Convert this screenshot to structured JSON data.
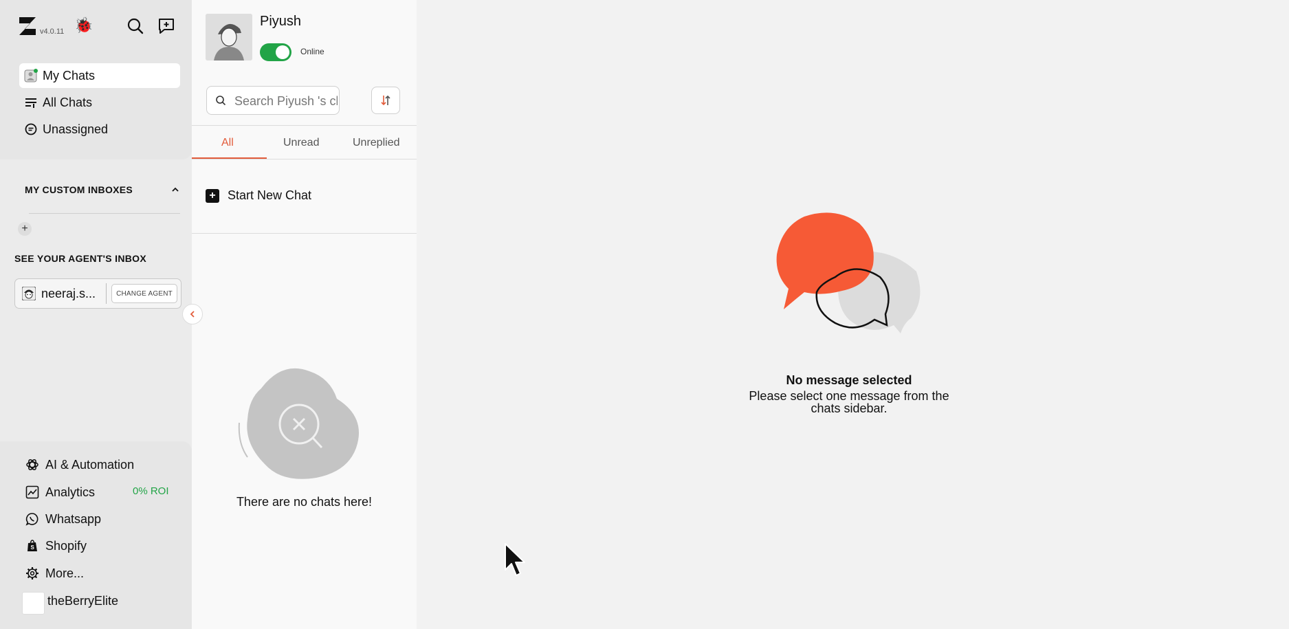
{
  "app": {
    "version": "v4.0.11"
  },
  "sidebar": {
    "nav": [
      {
        "label": "My Chats",
        "active": true
      },
      {
        "label": "All Chats",
        "active": false
      },
      {
        "label": "Unassigned",
        "active": false
      }
    ],
    "custom_inboxes_title": "MY CUSTOM INBOXES",
    "agent_inbox_title": "SEE YOUR AGENT'S INBOX",
    "agent": {
      "name": "neeraj.s...",
      "change_label": "CHANGE AGENT"
    },
    "bottom_nav": [
      {
        "label": "AI & Automation",
        "icon": "openai-icon"
      },
      {
        "label": "Analytics",
        "icon": "chart-icon"
      },
      {
        "label": "Whatsapp",
        "icon": "whatsapp-icon"
      },
      {
        "label": "Shopify",
        "icon": "shopify-icon"
      },
      {
        "label": "More...",
        "icon": "gear-icon"
      }
    ],
    "roi_text": "0% ROI",
    "store_name": "theBerryElite"
  },
  "chatlist": {
    "user_name": "Piyush",
    "status": "Online",
    "search_placeholder": "Search Piyush 's cl",
    "tabs": [
      "All",
      "Unread",
      "Unreplied"
    ],
    "new_chat_label": "Start New Chat",
    "empty_text": "There are no chats here!"
  },
  "main": {
    "title": "No message selected",
    "description": "Please select one message from the chats sidebar."
  },
  "colors": {
    "accent": "#e25b3a",
    "online": "#22a447",
    "bubble": "#f65a36"
  }
}
